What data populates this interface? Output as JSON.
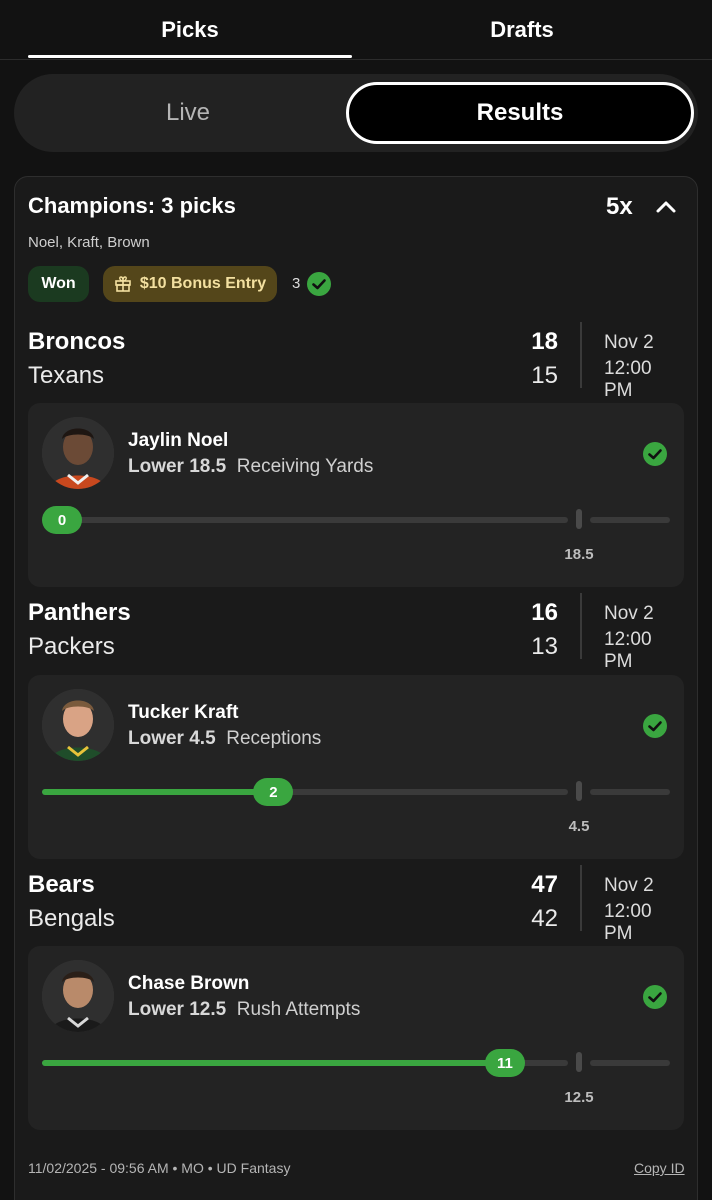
{
  "tabs": {
    "picks": "Picks",
    "drafts": "Drafts"
  },
  "segment": {
    "live": "Live",
    "results": "Results"
  },
  "card": {
    "title": "Champions: 3 picks",
    "multiplier": "5x",
    "subtitle": "Noel, Kraft, Brown",
    "status_badge": "Won",
    "bonus_badge": "$10 Bonus Entry",
    "wins_count": "3"
  },
  "games": [
    {
      "team1": "Broncos",
      "score1": "18",
      "team2": "Texans",
      "score2": "15",
      "date": "Nov 2",
      "time": "12:00 PM",
      "pick": {
        "player": "Jaylin Noel",
        "direction": "Lower",
        "line": "18.5",
        "stat": "Receiving Yards",
        "actual": "0",
        "progress": 0.0
      }
    },
    {
      "team1": "Panthers",
      "score1": "16",
      "team2": "Packers",
      "score2": "13",
      "date": "Nov 2",
      "time": "12:00 PM",
      "pick": {
        "player": "Tucker Kraft",
        "direction": "Lower",
        "line": "4.5",
        "stat": "Receptions",
        "actual": "2",
        "progress": 0.44
      }
    },
    {
      "team1": "Bears",
      "score1": "47",
      "team2": "Bengals",
      "score2": "42",
      "date": "Nov 2",
      "time": "12:00 PM",
      "pick": {
        "player": "Chase Brown",
        "direction": "Lower",
        "line": "12.5",
        "stat": "Rush Attempts",
        "actual": "11",
        "progress": 0.88
      }
    }
  ],
  "footer": {
    "meta": "11/02/2025 - 09:56 AM • MO • UD Fantasy",
    "copy_id": "Copy ID"
  },
  "colors": {
    "accent_green": "#3aa640",
    "won_bg": "#1b3a20",
    "bonus_bg": "#54461a",
    "background": "#121212"
  },
  "icons": {
    "collapse": "chevron-up-icon",
    "bonus": "gift-icon",
    "status": "check-circle-icon"
  }
}
